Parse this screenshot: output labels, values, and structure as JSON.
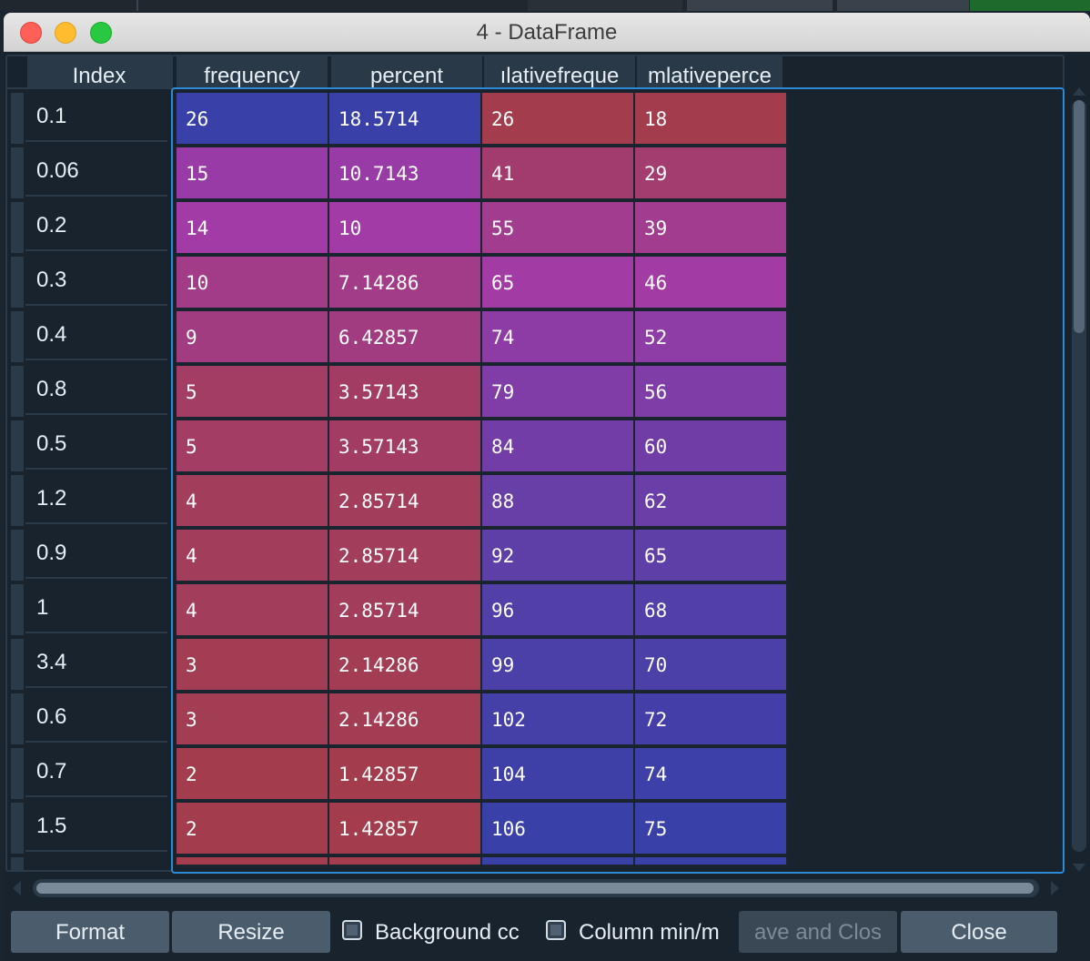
{
  "window": {
    "title": "4 - DataFrame"
  },
  "colors": {
    "accent": "#2d8ad6",
    "cell_max": "#3940a8",
    "cell_mid_purple": "#a23ba6",
    "cell_min": "#a33d4d"
  },
  "table": {
    "index_header": "Index",
    "columns": [
      "frequency",
      "percent",
      "ılativefreque",
      "mlativeperce"
    ],
    "rows": [
      {
        "index": "0.1",
        "values": [
          "26",
          "18.5714",
          "26",
          "18"
        ]
      },
      {
        "index": "0.06",
        "values": [
          "15",
          "10.7143",
          "41",
          "29"
        ]
      },
      {
        "index": "0.2",
        "values": [
          "14",
          "10",
          "55",
          "39"
        ]
      },
      {
        "index": "0.3",
        "values": [
          "10",
          "7.14286",
          "65",
          "46"
        ]
      },
      {
        "index": "0.4",
        "values": [
          "9",
          "6.42857",
          "74",
          "52"
        ]
      },
      {
        "index": "0.8",
        "values": [
          "5",
          "3.57143",
          "79",
          "56"
        ]
      },
      {
        "index": "0.5",
        "values": [
          "5",
          "3.57143",
          "84",
          "60"
        ]
      },
      {
        "index": "1.2",
        "values": [
          "4",
          "2.85714",
          "88",
          "62"
        ]
      },
      {
        "index": "0.9",
        "values": [
          "4",
          "2.85714",
          "92",
          "65"
        ]
      },
      {
        "index": "1",
        "values": [
          "4",
          "2.85714",
          "96",
          "68"
        ]
      },
      {
        "index": "3.4",
        "values": [
          "3",
          "2.14286",
          "99",
          "70"
        ]
      },
      {
        "index": "0.6",
        "values": [
          "3",
          "2.14286",
          "102",
          "72"
        ]
      },
      {
        "index": "0.7",
        "values": [
          "2",
          "1.42857",
          "104",
          "74"
        ]
      },
      {
        "index": "1.5",
        "values": [
          "2",
          "1.42857",
          "106",
          "75"
        ]
      }
    ]
  },
  "buttons": {
    "format": "Format",
    "resize": "Resize",
    "background_color": "Background cc",
    "column_minmax": "Column min/m",
    "save_and_close": "ave and Clos",
    "close": "Close"
  }
}
